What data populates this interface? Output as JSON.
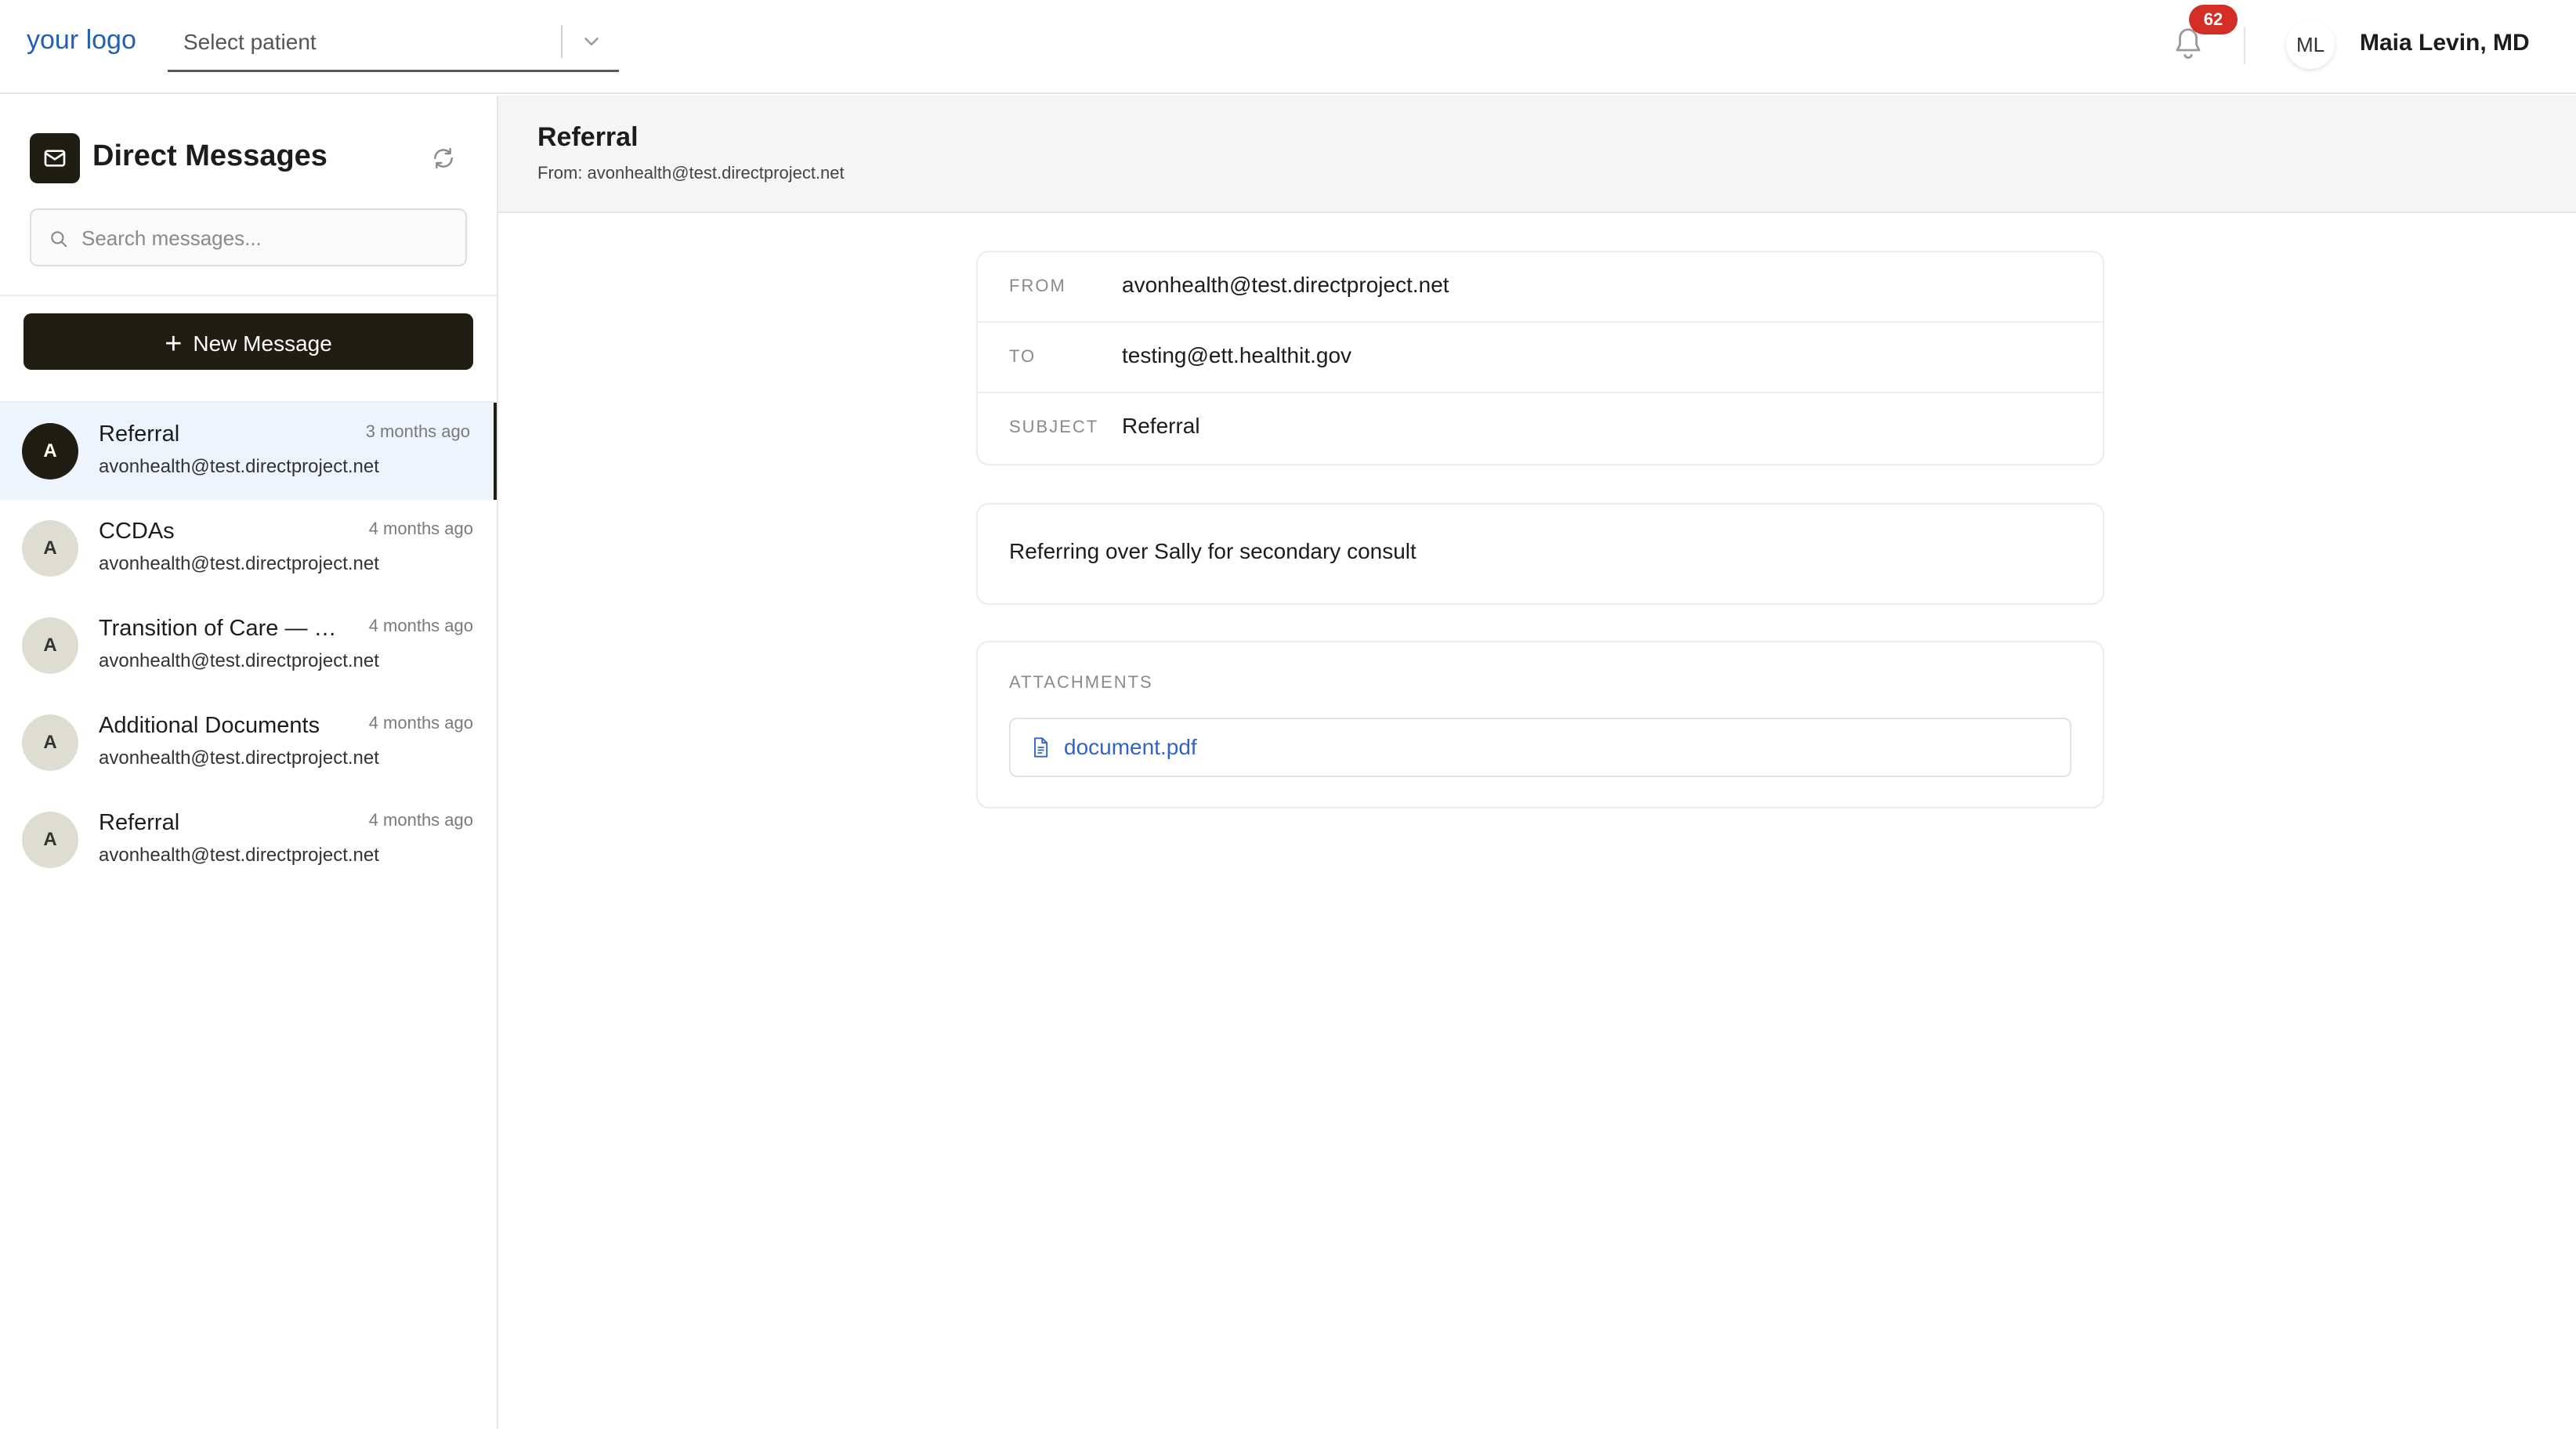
{
  "topbar": {
    "logo": "your logo",
    "patient_placeholder": "Select patient",
    "notification_count": "62",
    "user_initials": "ML",
    "user_name": "Maia Levin, MD"
  },
  "sidebar": {
    "title": "Direct Messages",
    "search_placeholder": "Search messages...",
    "new_message_label": "New Message",
    "messages": [
      {
        "initial": "A",
        "subject": "Referral",
        "from": "avonhealth@test.directproject.net",
        "time": "3 months ago",
        "active": true
      },
      {
        "initial": "A",
        "subject": "CCDAs",
        "from": "avonhealth@test.directproject.net",
        "time": "4 months ago",
        "active": false
      },
      {
        "initial": "A",
        "subject": "Transition of Care — Sa...",
        "from": "avonhealth@test.directproject.net",
        "time": "4 months ago",
        "active": false
      },
      {
        "initial": "A",
        "subject": "Additional Documents",
        "from": "avonhealth@test.directproject.net",
        "time": "4 months ago",
        "active": false
      },
      {
        "initial": "A",
        "subject": "Referral",
        "from": "avonhealth@test.directproject.net",
        "time": "4 months ago",
        "active": false
      }
    ]
  },
  "message": {
    "title": "Referral",
    "from_line": "From: avonhealth@test.directproject.net",
    "from_label": "FROM",
    "from_value": "avonhealth@test.directproject.net",
    "to_label": "TO",
    "to_value": "testing@ett.healthit.gov",
    "subject_label": "SUBJECT",
    "subject_value": "Referral",
    "body": "Referring over Sally for secondary consult",
    "attachments_label": "ATTACHMENTS",
    "attachments": [
      "document.pdf"
    ]
  },
  "colors": {
    "brand_dark": "#201d12",
    "logo_blue": "#1f5fb5",
    "badge_red": "#d22e25",
    "active_row": "#eef4fc",
    "link_blue": "#2f63c9"
  }
}
